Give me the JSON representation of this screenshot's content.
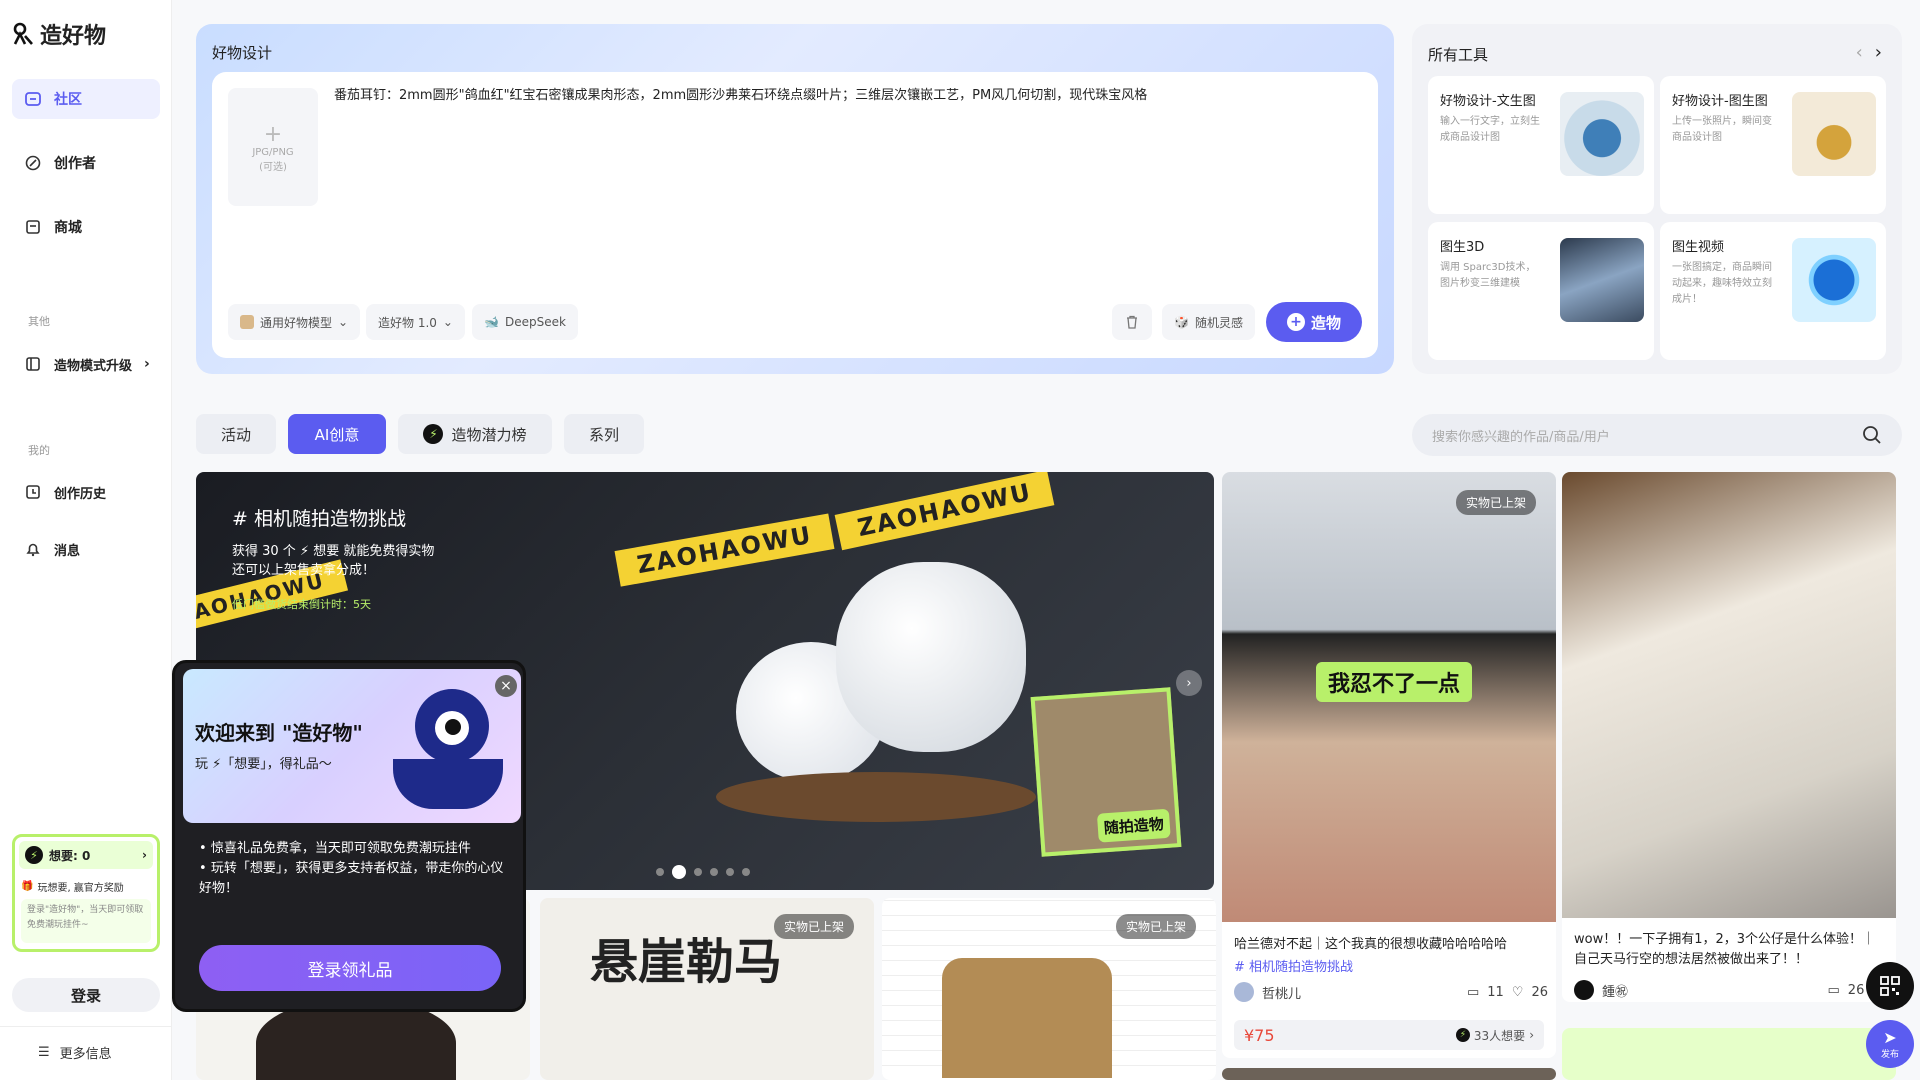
{
  "brand": {
    "name": "造好物"
  },
  "sidebar": {
    "items": [
      {
        "label": "社区"
      },
      {
        "label": "创作者"
      },
      {
        "label": "商城"
      }
    ],
    "section_other": "其他",
    "upgrade": "造物模式升级",
    "section_mine": "我的",
    "history": "创作历史",
    "messages": "消息",
    "wish": {
      "label": "想要: 0",
      "reward": "玩想要, 赢官方奖励",
      "desc": "登录\"造好物\"，当天即可领取免费潮玩挂件~"
    },
    "login": "登录",
    "more": "更多信息"
  },
  "design": {
    "title": "好物设计",
    "upload_hint": "JPG/PNG",
    "upload_optional": "(可选)",
    "prompt": "番茄耳钉：2mm圆形\"鸽血红\"红宝石密镶成果肉形态，2mm圆形沙弗莱石环绕点缀叶片；三维层次镶嵌工艺，PM风几何切割，现代珠宝风格",
    "model": "通用好物模型",
    "version": "造好物 1.0",
    "llm": "DeepSeek",
    "random": "随机灵感",
    "make": "造物"
  },
  "tools": {
    "title": "所有工具",
    "cards": [
      {
        "title": "好物设计-文生图",
        "desc": "输入一行文字，立刻生成商品设计图"
      },
      {
        "title": "好物设计-图生图",
        "desc": "上传一张照片，瞬间变商品设计图"
      },
      {
        "title": "图生3D",
        "desc": "调用 Sparc3D技术，图片秒变三维建模"
      },
      {
        "title": "图生视频",
        "desc": "一张图搞定，商品瞬间动起来，趣味特效立刻成片！"
      }
    ]
  },
  "tabs": [
    {
      "label": "活动"
    },
    {
      "label": "AI创意"
    },
    {
      "label": "造物潜力榜"
    },
    {
      "label": "系列"
    }
  ],
  "search": {
    "placeholder": "搜索你感兴趣的作品/商品/用户"
  },
  "banner": {
    "tag": "# 相机随拍造物挑战",
    "line1": "获得 30 个 ⚡ 想要 就能免费得实物",
    "line2": "还可以上架售卖拿分成！",
    "countdown": "低门槛做货结束倒计时：5天",
    "tape": "ZAOHAOWU",
    "sign": "随拍造物"
  },
  "feed": {
    "on_shelf": "实物已上架",
    "card1": {
      "title": "哈兰德对不起｜这个我真的很想收藏哈哈哈哈哈",
      "tag": "# 相机随拍造物挑战",
      "user": "哲桃儿",
      "comments": "11",
      "likes": "26",
      "price": "¥75",
      "wants": "33人想要",
      "caption": "我忍不了一点"
    },
    "card2": {
      "title": "wow！！一下子拥有1，2，3个公仔是什么体验！｜自己天马行空的想法居然被做出来了！！",
      "user": "鍾㊗",
      "comments": "26"
    },
    "card3_text": "悬崖勒马"
  },
  "modal": {
    "title": "欢迎来到 \"造好物\"",
    "sub": "玩 ⚡「想要」，得礼品～",
    "bullet1": "惊喜礼品免费拿，当天即可领取免费潮玩挂件",
    "bullet2": "玩转「想要」，获得更多支持者权益，带走你的心仪好物！",
    "button": "登录领礼品"
  },
  "publish": "发布",
  "colors": {
    "accent": "#5b5cf0",
    "wish": "#b8f06a",
    "price": "#e8483a"
  }
}
